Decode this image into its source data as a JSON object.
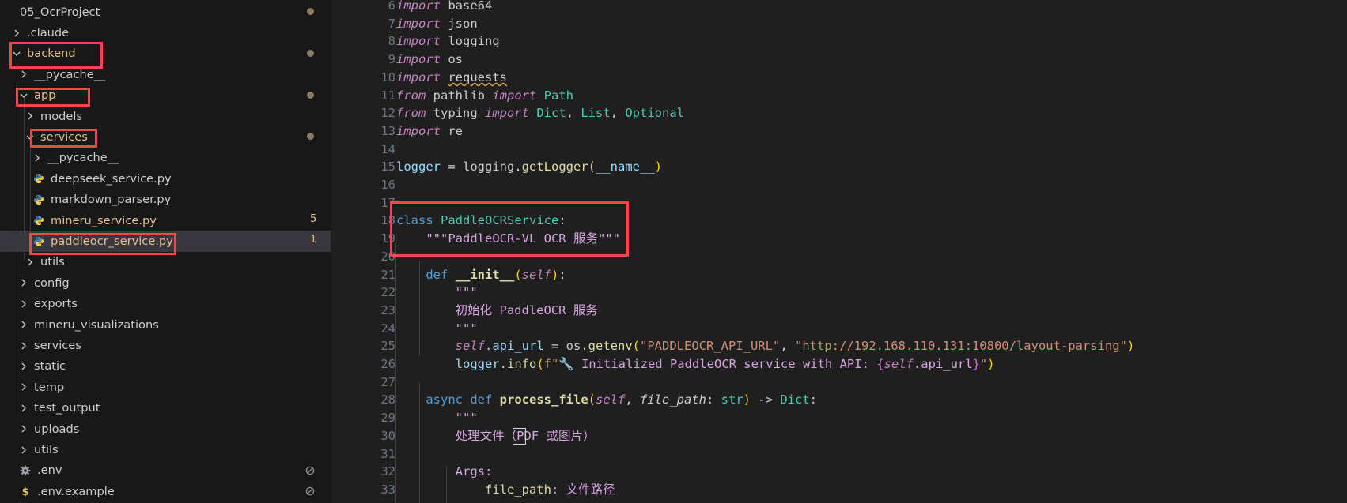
{
  "explorer": {
    "items": [
      {
        "label": "05_OcrProject",
        "depth": 0,
        "type": "folder-root",
        "status": "dot"
      },
      {
        "label": ".claude",
        "depth": 1,
        "type": "folder",
        "expanded": false
      },
      {
        "label": "backend",
        "depth": 1,
        "type": "folder",
        "expanded": true,
        "status": "dot",
        "modified": true
      },
      {
        "label": "__pycache__",
        "depth": 2,
        "type": "folder",
        "expanded": false
      },
      {
        "label": "app",
        "depth": 2,
        "type": "folder",
        "expanded": true,
        "status": "dot",
        "modified": true
      },
      {
        "label": "models",
        "depth": 3,
        "type": "folder",
        "expanded": false
      },
      {
        "label": "services",
        "depth": 3,
        "type": "folder",
        "expanded": true,
        "status": "dot",
        "modified": true
      },
      {
        "label": "__pycache__",
        "depth": 4,
        "type": "folder",
        "expanded": false
      },
      {
        "label": "deepseek_service.py",
        "depth": 4,
        "type": "python-file"
      },
      {
        "label": "markdown_parser.py",
        "depth": 4,
        "type": "python-file"
      },
      {
        "label": "mineru_service.py",
        "depth": 4,
        "type": "python-file",
        "status": "5",
        "modified": true
      },
      {
        "label": "paddleocr_service.py",
        "depth": 4,
        "type": "python-file",
        "status": "1",
        "modified": true,
        "selected": true
      },
      {
        "label": "utils",
        "depth": 3,
        "type": "folder",
        "expanded": false
      },
      {
        "label": "config",
        "depth": 2,
        "type": "folder",
        "expanded": false
      },
      {
        "label": "exports",
        "depth": 2,
        "type": "folder",
        "expanded": false
      },
      {
        "label": "mineru_visualizations",
        "depth": 2,
        "type": "folder",
        "expanded": false
      },
      {
        "label": "services",
        "depth": 2,
        "type": "folder",
        "expanded": false
      },
      {
        "label": "static",
        "depth": 2,
        "type": "folder",
        "expanded": false
      },
      {
        "label": "temp",
        "depth": 2,
        "type": "folder",
        "expanded": false
      },
      {
        "label": "test_output",
        "depth": 2,
        "type": "folder",
        "expanded": false
      },
      {
        "label": "uploads",
        "depth": 2,
        "type": "folder",
        "expanded": false
      },
      {
        "label": "utils",
        "depth": 2,
        "type": "folder",
        "expanded": false
      },
      {
        "label": ".env",
        "depth": 2,
        "type": "gear-file",
        "status": "ignored"
      },
      {
        "label": ".env.example",
        "depth": 2,
        "type": "dollar-file",
        "status": "ignored"
      }
    ]
  },
  "editor": {
    "language": "python",
    "lines": [
      {
        "n": "6",
        "text": "import base64"
      },
      {
        "n": "7",
        "text": "import json"
      },
      {
        "n": "8",
        "text": "import logging"
      },
      {
        "n": "9",
        "text": "import os"
      },
      {
        "n": "10",
        "text": "import requests"
      },
      {
        "n": "11",
        "text": "from pathlib import Path"
      },
      {
        "n": "12",
        "text": "from typing import Dict, List, Optional"
      },
      {
        "n": "13",
        "text": "import re"
      },
      {
        "n": "14",
        "text": ""
      },
      {
        "n": "15",
        "text": "logger = logging.getLogger(__name__)"
      },
      {
        "n": "16",
        "text": ""
      },
      {
        "n": "17",
        "text": ""
      },
      {
        "n": "18",
        "text": "class PaddleOCRService:"
      },
      {
        "n": "19",
        "text": "    \"\"\"PaddleOCR-VL OCR 服务\"\"\""
      },
      {
        "n": "20",
        "text": ""
      },
      {
        "n": "21",
        "text": "    def __init__(self):"
      },
      {
        "n": "22",
        "text": "        \"\"\""
      },
      {
        "n": "23",
        "text": "        初始化 PaddleOCR 服务"
      },
      {
        "n": "24",
        "text": "        \"\"\""
      },
      {
        "n": "25",
        "text": "        self.api_url = os.getenv(\"PADDLEOCR_API_URL\", \"http://192.168.110.131:10800/layout-parsing\")"
      },
      {
        "n": "26",
        "text": "        logger.info(f\"🔧 Initialized PaddleOCR service with API: {self.api_url}\")"
      },
      {
        "n": "27",
        "text": ""
      },
      {
        "n": "28",
        "text": "    async def process_file(self, file_path: str) -> Dict:"
      },
      {
        "n": "29",
        "text": "        \"\"\""
      },
      {
        "n": "30",
        "text": "        处理文件（PDF 或图片）"
      },
      {
        "n": "31",
        "text": ""
      },
      {
        "n": "32",
        "text": "        Args:"
      },
      {
        "n": "33",
        "text": "            file_path: 文件路径"
      }
    ]
  },
  "colors": {
    "highlight_box": "#f04848",
    "modified": "#e2c08d",
    "python_icon": "#4b8bbe"
  }
}
